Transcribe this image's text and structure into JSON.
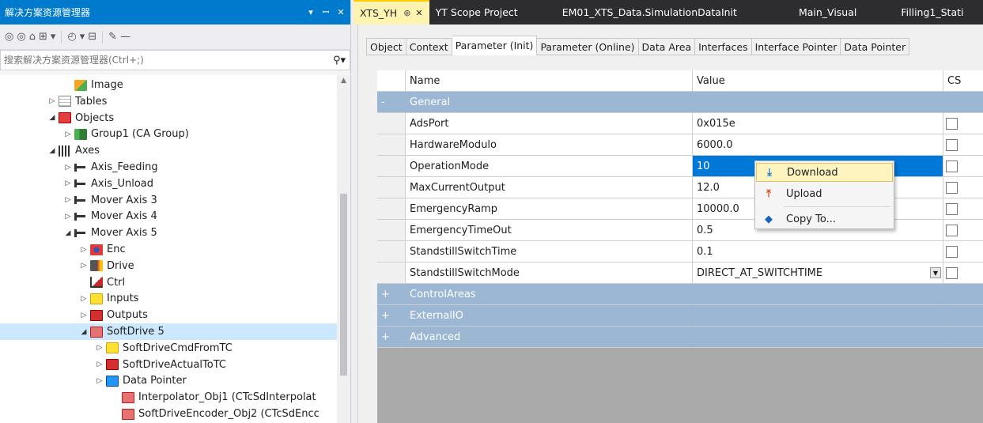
{
  "solution_explorer": {
    "title": "解决方案资源管理器",
    "title_buttons": [
      "▾",
      "ꟷ",
      "✕"
    ],
    "search_placeholder": "搜索解决方案资源管理器(Ctrl+;)",
    "tree": [
      {
        "label": "Image",
        "icon": "image-icon",
        "arrow": "",
        "level": 4
      },
      {
        "label": "Tables",
        "icon": "table-icon",
        "arrow": "▷",
        "level": 3
      },
      {
        "label": "Objects",
        "icon": "objects-icon",
        "arrow": "◢",
        "level": 3
      },
      {
        "label": "Group1 (CA Group)",
        "icon": "group-icon",
        "arrow": "▷",
        "level": 4
      },
      {
        "label": "Axes",
        "icon": "axes-icon",
        "arrow": "◢",
        "level": 3
      },
      {
        "label": "Axis_Feeding",
        "icon": "axis-icon",
        "arrow": "▷",
        "level": 4
      },
      {
        "label": "Axis_Unload",
        "icon": "axis-icon",
        "arrow": "▷",
        "level": 4
      },
      {
        "label": "Mover Axis 3",
        "icon": "axis-icon",
        "arrow": "▷",
        "level": 4
      },
      {
        "label": "Mover Axis 4",
        "icon": "axis-icon",
        "arrow": "▷",
        "level": 4
      },
      {
        "label": "Mover Axis 5",
        "icon": "axis-icon",
        "arrow": "◢",
        "level": 4
      },
      {
        "label": "Enc",
        "icon": "encoder-icon",
        "arrow": "▷",
        "level": 5
      },
      {
        "label": "Drive",
        "icon": "drive-icon",
        "arrow": "▷",
        "level": 5
      },
      {
        "label": "Ctrl",
        "icon": "ctrl-icon",
        "arrow": "",
        "level": 5
      },
      {
        "label": "Inputs",
        "icon": "inputs-icon",
        "arrow": "▷",
        "level": 5
      },
      {
        "label": "Outputs",
        "icon": "outputs-icon",
        "arrow": "▷",
        "level": 5
      },
      {
        "label": "SoftDrive 5",
        "icon": "softdrive-icon",
        "arrow": "◢",
        "level": 5,
        "selected": true
      },
      {
        "label": "SoftDriveCmdFromTC",
        "icon": "inputs-icon",
        "arrow": "▷",
        "level": 6
      },
      {
        "label": "SoftDriveActualToTC",
        "icon": "outputs-icon",
        "arrow": "▷",
        "level": 6
      },
      {
        "label": "Data Pointer",
        "icon": "data-pointer-icon",
        "arrow": "▷",
        "level": 6
      },
      {
        "label": "Interpolator_Obj1 (CTcSdInterpolat",
        "icon": "softdrive-icon",
        "arrow": "",
        "level": 7
      },
      {
        "label": "SoftDriveEncoder_Obj2 (CTcSdEncc",
        "icon": "softdrive-icon",
        "arrow": "",
        "level": 7
      }
    ]
  },
  "doc_tabs": [
    {
      "label": "XTS_YH",
      "active": true,
      "pin": "⊕",
      "close": "✕"
    },
    {
      "label": "YT Scope Project",
      "active": false
    },
    {
      "label": "EM01_XTS_Data.SimulationDataInit",
      "active": false
    },
    {
      "label": "Main_Visual",
      "active": false
    },
    {
      "label": "Filling1_Stati",
      "active": false
    }
  ],
  "prop_tabs": [
    "Object",
    "Context",
    "Parameter (Init)",
    "Parameter (Online)",
    "Data Area",
    "Interfaces",
    "Interface Pointer",
    "Data Pointer"
  ],
  "active_prop_tab": "Parameter (Init)",
  "grid": {
    "headers": {
      "name": "Name",
      "value": "Value",
      "cs": "CS"
    },
    "rows": [
      {
        "type": "category",
        "toggle": "-",
        "name": "General",
        "value": ""
      },
      {
        "type": "param",
        "name": "AdsPort",
        "value": "0x015e"
      },
      {
        "type": "param",
        "name": "HardwareModulo",
        "value": "6000.0"
      },
      {
        "type": "param",
        "name": "OperationMode",
        "value": "10",
        "selected": true
      },
      {
        "type": "param",
        "name": "MaxCurrentOutput",
        "value": "12.0"
      },
      {
        "type": "param",
        "name": "EmergencyRamp",
        "value": "10000.0"
      },
      {
        "type": "param",
        "name": "EmergencyTimeOut",
        "value": "0.5"
      },
      {
        "type": "param",
        "name": "StandstillSwitchTime",
        "value": "0.1"
      },
      {
        "type": "param",
        "name": "StandstillSwitchMode",
        "value": "DIRECT_AT_SWITCHTIME",
        "dropdown": true
      },
      {
        "type": "category",
        "toggle": "+",
        "name": "ControlAreas",
        "value": ""
      },
      {
        "type": "category",
        "toggle": "+",
        "name": "ExternalIO",
        "value": ""
      },
      {
        "type": "category",
        "toggle": "+",
        "name": "Advanced",
        "value": ""
      }
    ]
  },
  "context_menu": {
    "items": [
      {
        "label": "Download",
        "icon": "download-icon",
        "glyph": "⤓",
        "hover": true
      },
      {
        "label": "Upload",
        "icon": "upload-icon",
        "glyph": "⤒",
        "hover": false
      },
      {
        "label": "Copy To...",
        "icon": "copy-to-icon",
        "glyph": "◆",
        "hover": false
      }
    ]
  },
  "colors": {
    "title_bar": "#007acc",
    "category_row": "#9bb7d4",
    "selected_value": "#0078d7",
    "active_doc_tab": "#fff3b0"
  }
}
